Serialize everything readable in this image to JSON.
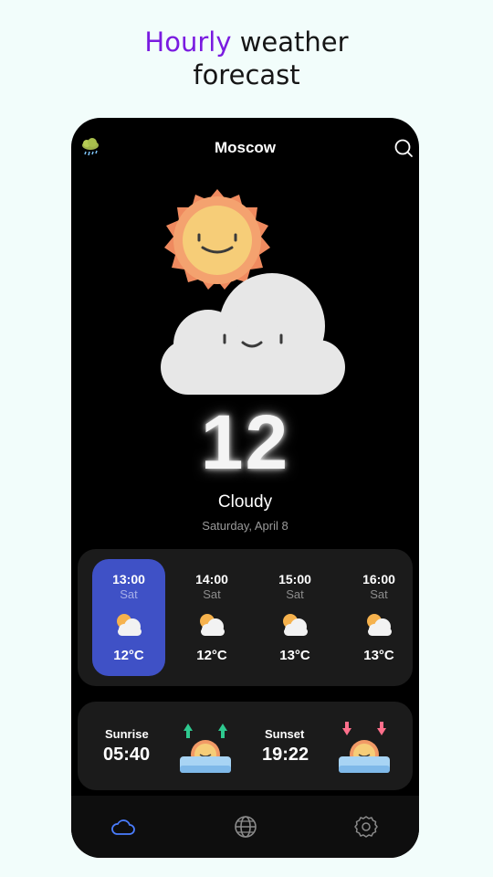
{
  "headline": {
    "accent": "Hourly",
    "rest": " weather",
    "line2": "forecast"
  },
  "topbar": {
    "city": "Moscow",
    "left_icon": "rain-cloud-icon",
    "right_icon": "search-icon"
  },
  "current": {
    "temperature": "12",
    "condition": "Cloudy",
    "date": "Saturday, April 8"
  },
  "hourly": [
    {
      "time": "13:00",
      "day": "Sat",
      "temp": "12°C",
      "icon": "partly-cloudy-icon",
      "active": true
    },
    {
      "time": "14:00",
      "day": "Sat",
      "temp": "12°C",
      "icon": "partly-cloudy-icon",
      "active": false
    },
    {
      "time": "15:00",
      "day": "Sat",
      "temp": "13°C",
      "icon": "partly-cloudy-icon",
      "active": false
    },
    {
      "time": "16:00",
      "day": "Sat",
      "temp": "13°C",
      "icon": "partly-cloudy-icon",
      "active": false
    }
  ],
  "sun": {
    "sunrise_label": "Sunrise",
    "sunrise_time": "05:40",
    "sunset_label": "Sunset",
    "sunset_time": "19:22"
  },
  "nav": [
    {
      "name": "weather",
      "icon": "cloud-icon",
      "active": true
    },
    {
      "name": "globe",
      "icon": "globe-icon",
      "active": false
    },
    {
      "name": "settings",
      "icon": "gear-icon",
      "active": false
    }
  ],
  "colors": {
    "accent": "#7a1be0",
    "active_card": "#3f51c6",
    "nav_active": "#4a7dff",
    "background": "#f2fdfb"
  }
}
